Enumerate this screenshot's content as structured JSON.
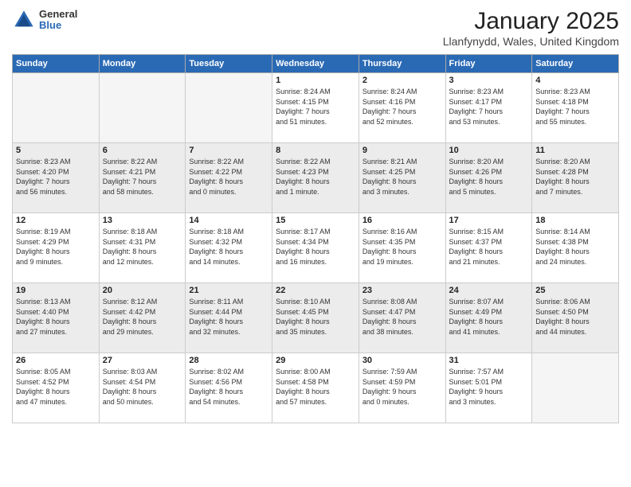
{
  "logo": {
    "general": "General",
    "blue": "Blue"
  },
  "header": {
    "title": "January 2025",
    "location": "Llanfynydd, Wales, United Kingdom"
  },
  "weekdays": [
    "Sunday",
    "Monday",
    "Tuesday",
    "Wednesday",
    "Thursday",
    "Friday",
    "Saturday"
  ],
  "weeks": [
    [
      {
        "day": "",
        "info": ""
      },
      {
        "day": "",
        "info": ""
      },
      {
        "day": "",
        "info": ""
      },
      {
        "day": "1",
        "info": "Sunrise: 8:24 AM\nSunset: 4:15 PM\nDaylight: 7 hours\nand 51 minutes."
      },
      {
        "day": "2",
        "info": "Sunrise: 8:24 AM\nSunset: 4:16 PM\nDaylight: 7 hours\nand 52 minutes."
      },
      {
        "day": "3",
        "info": "Sunrise: 8:23 AM\nSunset: 4:17 PM\nDaylight: 7 hours\nand 53 minutes."
      },
      {
        "day": "4",
        "info": "Sunrise: 8:23 AM\nSunset: 4:18 PM\nDaylight: 7 hours\nand 55 minutes."
      }
    ],
    [
      {
        "day": "5",
        "info": "Sunrise: 8:23 AM\nSunset: 4:20 PM\nDaylight: 7 hours\nand 56 minutes."
      },
      {
        "day": "6",
        "info": "Sunrise: 8:22 AM\nSunset: 4:21 PM\nDaylight: 7 hours\nand 58 minutes."
      },
      {
        "day": "7",
        "info": "Sunrise: 8:22 AM\nSunset: 4:22 PM\nDaylight: 8 hours\nand 0 minutes."
      },
      {
        "day": "8",
        "info": "Sunrise: 8:22 AM\nSunset: 4:23 PM\nDaylight: 8 hours\nand 1 minute."
      },
      {
        "day": "9",
        "info": "Sunrise: 8:21 AM\nSunset: 4:25 PM\nDaylight: 8 hours\nand 3 minutes."
      },
      {
        "day": "10",
        "info": "Sunrise: 8:20 AM\nSunset: 4:26 PM\nDaylight: 8 hours\nand 5 minutes."
      },
      {
        "day": "11",
        "info": "Sunrise: 8:20 AM\nSunset: 4:28 PM\nDaylight: 8 hours\nand 7 minutes."
      }
    ],
    [
      {
        "day": "12",
        "info": "Sunrise: 8:19 AM\nSunset: 4:29 PM\nDaylight: 8 hours\nand 9 minutes."
      },
      {
        "day": "13",
        "info": "Sunrise: 8:18 AM\nSunset: 4:31 PM\nDaylight: 8 hours\nand 12 minutes."
      },
      {
        "day": "14",
        "info": "Sunrise: 8:18 AM\nSunset: 4:32 PM\nDaylight: 8 hours\nand 14 minutes."
      },
      {
        "day": "15",
        "info": "Sunrise: 8:17 AM\nSunset: 4:34 PM\nDaylight: 8 hours\nand 16 minutes."
      },
      {
        "day": "16",
        "info": "Sunrise: 8:16 AM\nSunset: 4:35 PM\nDaylight: 8 hours\nand 19 minutes."
      },
      {
        "day": "17",
        "info": "Sunrise: 8:15 AM\nSunset: 4:37 PM\nDaylight: 8 hours\nand 21 minutes."
      },
      {
        "day": "18",
        "info": "Sunrise: 8:14 AM\nSunset: 4:38 PM\nDaylight: 8 hours\nand 24 minutes."
      }
    ],
    [
      {
        "day": "19",
        "info": "Sunrise: 8:13 AM\nSunset: 4:40 PM\nDaylight: 8 hours\nand 27 minutes."
      },
      {
        "day": "20",
        "info": "Sunrise: 8:12 AM\nSunset: 4:42 PM\nDaylight: 8 hours\nand 29 minutes."
      },
      {
        "day": "21",
        "info": "Sunrise: 8:11 AM\nSunset: 4:44 PM\nDaylight: 8 hours\nand 32 minutes."
      },
      {
        "day": "22",
        "info": "Sunrise: 8:10 AM\nSunset: 4:45 PM\nDaylight: 8 hours\nand 35 minutes."
      },
      {
        "day": "23",
        "info": "Sunrise: 8:08 AM\nSunset: 4:47 PM\nDaylight: 8 hours\nand 38 minutes."
      },
      {
        "day": "24",
        "info": "Sunrise: 8:07 AM\nSunset: 4:49 PM\nDaylight: 8 hours\nand 41 minutes."
      },
      {
        "day": "25",
        "info": "Sunrise: 8:06 AM\nSunset: 4:50 PM\nDaylight: 8 hours\nand 44 minutes."
      }
    ],
    [
      {
        "day": "26",
        "info": "Sunrise: 8:05 AM\nSunset: 4:52 PM\nDaylight: 8 hours\nand 47 minutes."
      },
      {
        "day": "27",
        "info": "Sunrise: 8:03 AM\nSunset: 4:54 PM\nDaylight: 8 hours\nand 50 minutes."
      },
      {
        "day": "28",
        "info": "Sunrise: 8:02 AM\nSunset: 4:56 PM\nDaylight: 8 hours\nand 54 minutes."
      },
      {
        "day": "29",
        "info": "Sunrise: 8:00 AM\nSunset: 4:58 PM\nDaylight: 8 hours\nand 57 minutes."
      },
      {
        "day": "30",
        "info": "Sunrise: 7:59 AM\nSunset: 4:59 PM\nDaylight: 9 hours\nand 0 minutes."
      },
      {
        "day": "31",
        "info": "Sunrise: 7:57 AM\nSunset: 5:01 PM\nDaylight: 9 hours\nand 3 minutes."
      },
      {
        "day": "",
        "info": ""
      }
    ]
  ]
}
